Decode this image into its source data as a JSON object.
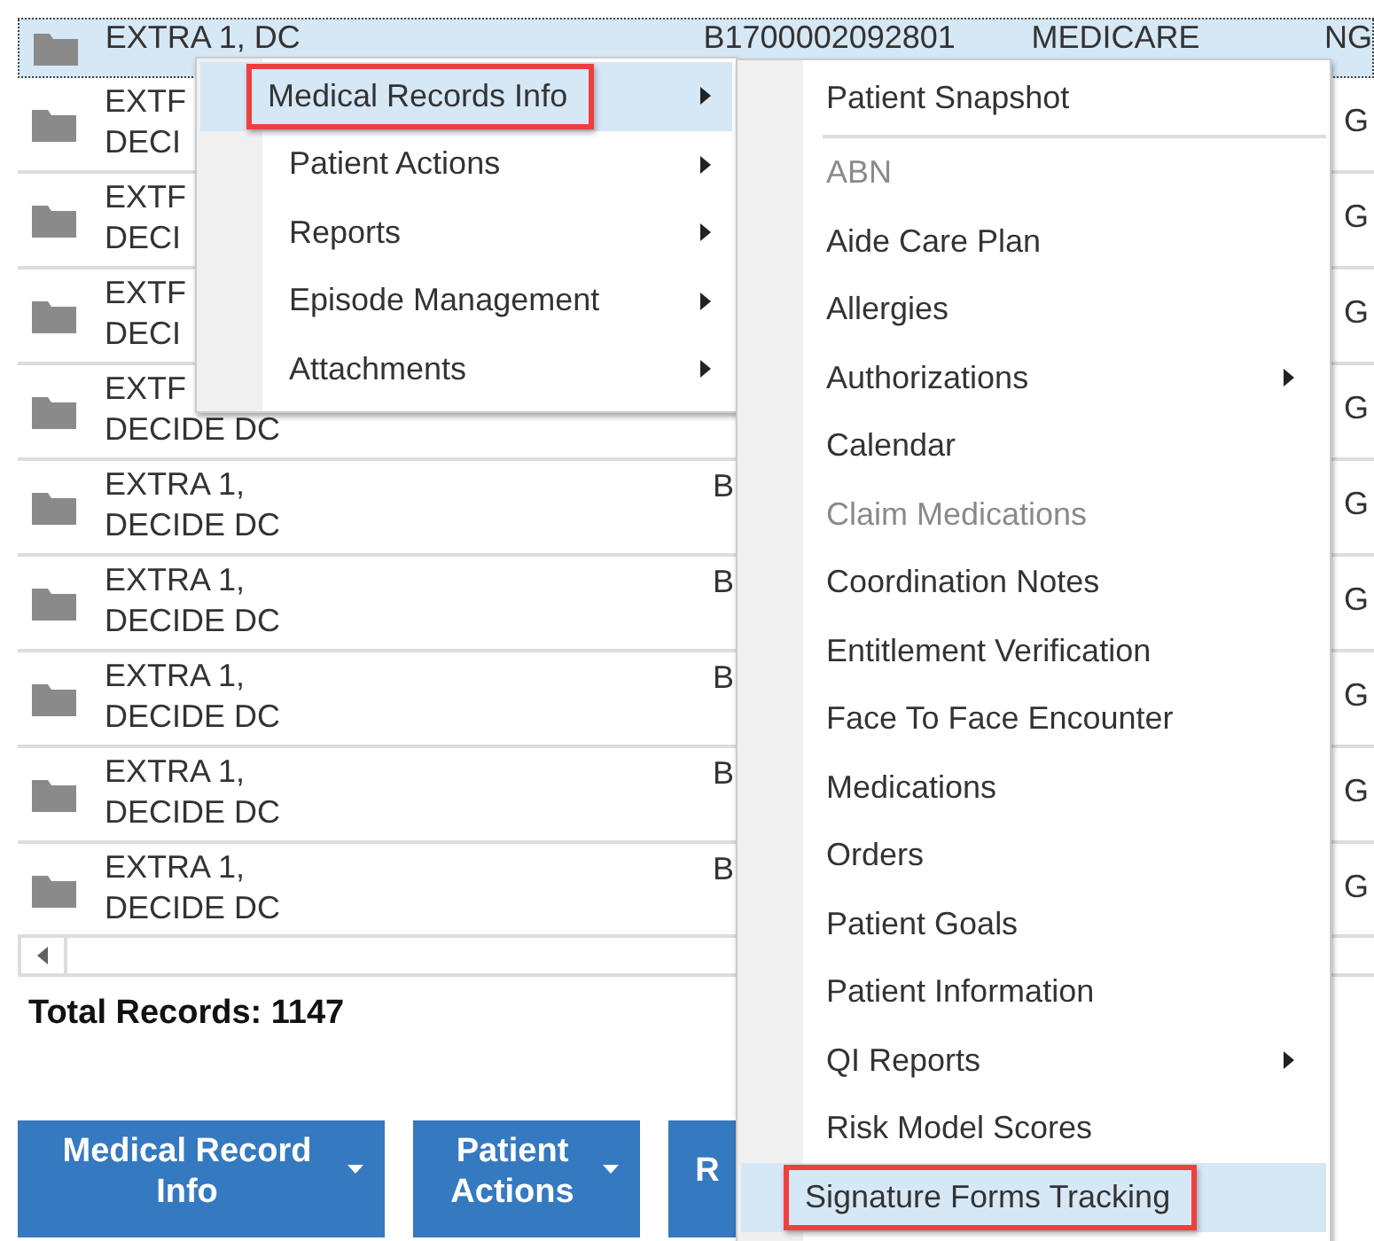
{
  "grid": {
    "rows": [
      {
        "lines": [
          "EXTRA 1, DC"
        ],
        "column_2": "B1700002092801",
        "column_3": "MEDICARE",
        "column_4": "NG",
        "selected": true
      },
      {
        "lines": [
          "EXTF",
          "DECI"
        ],
        "column_4": "G",
        "selected": false
      },
      {
        "lines": [
          "EXTF",
          "DECI"
        ],
        "column_4": "G",
        "selected": false
      },
      {
        "lines": [
          "EXTF",
          "DECI"
        ],
        "column_4": "G",
        "selected": false
      },
      {
        "lines": [
          "EXTF",
          "DECIDE DC"
        ],
        "column_4": "G",
        "selected": false
      },
      {
        "lines": [
          "EXTRA 1,",
          "DECIDE DC"
        ],
        "column_2": "B",
        "column_4": "G",
        "selected": false
      },
      {
        "lines": [
          "EXTRA 1,",
          "DECIDE DC"
        ],
        "column_2": "B",
        "column_4": "G",
        "selected": false
      },
      {
        "lines": [
          "EXTRA 1,",
          "DECIDE DC"
        ],
        "column_2": "B",
        "column_4": "G",
        "selected": false
      },
      {
        "lines": [
          "EXTRA 1,",
          "DECIDE DC"
        ],
        "column_2": "B",
        "column_4": "G",
        "selected": false
      },
      {
        "lines": [
          "EXTRA 1,",
          "DECIDE DC"
        ],
        "column_2": "B",
        "column_4": "G",
        "selected": false
      }
    ]
  },
  "total_records": "Total Records: 1147",
  "buttons": [
    {
      "label": "Medical Record Info",
      "dropdown": true
    },
    {
      "label": "Patient Actions",
      "dropdown": true
    },
    {
      "label": "R",
      "dropdown": false
    }
  ],
  "context_menu": {
    "items": [
      {
        "label": "Medical Records Info",
        "submenu": true,
        "selected": true
      },
      {
        "label": "Patient Actions",
        "submenu": true,
        "selected": false
      },
      {
        "label": "Reports",
        "submenu": true,
        "selected": false
      },
      {
        "label": "Episode Management",
        "submenu": true,
        "selected": false
      },
      {
        "label": "Attachments",
        "submenu": true,
        "selected": false
      }
    ]
  },
  "submenu": {
    "items": [
      {
        "kind": "item",
        "label": "Patient Snapshot",
        "disabled": false,
        "submenu": false,
        "selected": false
      },
      {
        "kind": "separator"
      },
      {
        "kind": "item",
        "label": "ABN",
        "disabled": true,
        "submenu": false,
        "selected": false
      },
      {
        "kind": "item",
        "label": "Aide Care Plan",
        "disabled": false,
        "submenu": false,
        "selected": false
      },
      {
        "kind": "item",
        "label": "Allergies",
        "disabled": false,
        "submenu": false,
        "selected": false
      },
      {
        "kind": "item",
        "label": "Authorizations",
        "disabled": false,
        "submenu": true,
        "selected": false
      },
      {
        "kind": "item",
        "label": "Calendar",
        "disabled": false,
        "submenu": false,
        "selected": false
      },
      {
        "kind": "item",
        "label": "Claim Medications",
        "disabled": true,
        "submenu": false,
        "selected": false
      },
      {
        "kind": "item",
        "label": "Coordination Notes",
        "disabled": false,
        "submenu": false,
        "selected": false
      },
      {
        "kind": "item",
        "label": "Entitlement Verification",
        "disabled": false,
        "submenu": false,
        "selected": false
      },
      {
        "kind": "item",
        "label": "Face To Face Encounter",
        "disabled": false,
        "submenu": false,
        "selected": false
      },
      {
        "kind": "item",
        "label": "Medications",
        "disabled": false,
        "submenu": false,
        "selected": false
      },
      {
        "kind": "item",
        "label": "Orders",
        "disabled": false,
        "submenu": false,
        "selected": false
      },
      {
        "kind": "item",
        "label": "Patient Goals",
        "disabled": false,
        "submenu": false,
        "selected": false
      },
      {
        "kind": "item",
        "label": "Patient Information",
        "disabled": false,
        "submenu": false,
        "selected": false
      },
      {
        "kind": "item",
        "label": "QI Reports",
        "disabled": false,
        "submenu": true,
        "selected": false
      },
      {
        "kind": "item",
        "label": "Risk Model Scores",
        "disabled": false,
        "submenu": false,
        "selected": false
      },
      {
        "kind": "item",
        "label": "Signature Forms Tracking",
        "disabled": false,
        "submenu": false,
        "selected": true
      }
    ]
  }
}
